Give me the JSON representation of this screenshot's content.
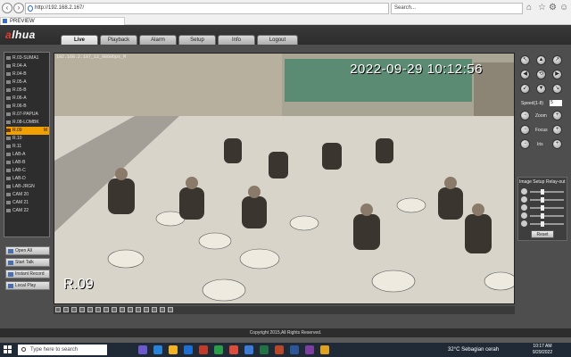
{
  "browser": {
    "url": "http://192.168.2.167/",
    "search_placeholder": "Search...",
    "tab_title": "PREVIEW"
  },
  "app": {
    "logo": "alhua",
    "tabs": [
      "Live",
      "Playback",
      "Alarm",
      "Setup",
      "Info",
      "Logout"
    ],
    "active_tab": "Live",
    "footer": "Copyright 2015,All Rights Reserved."
  },
  "channels": [
    "R.03-SUMA1",
    "R.04-A",
    "R.04-B",
    "R.05-A",
    "R.05-B",
    "R.06-A",
    "R.06-B",
    "R.07-PAPUA",
    "R.08-LOMBK",
    "R.09",
    "R.10",
    "R.11",
    "LAB-A",
    "LAB-B",
    "LAB-C",
    "LAB-D",
    "LAB-JRGN",
    "CAM 20",
    "CAM 21",
    "CAM 22"
  ],
  "selected_channel": "R.09",
  "selected_channel_flag": "M",
  "left_buttons": [
    "Open All",
    "Start Talk",
    "Instant Record",
    "Local Play"
  ],
  "video": {
    "osd_top": "192.168.2.167_12_9860bps_M",
    "timestamp": "2022-09-29 10:12:56",
    "camera_name": "R.09"
  },
  "ptz": {
    "speed_label": "Speed(1-8)",
    "speed_value": "5",
    "zoom_label": "Zoom",
    "focus_label": "Focus",
    "iris_label": "Iris",
    "image_setup_label": "Image Setup",
    "relay_label": "Relay-out",
    "reset_label": "Reset",
    "slider_levels": [
      0.35,
      0.35,
      0.35,
      0.35,
      0.35
    ]
  },
  "taskbar": {
    "search_placeholder": "Type here to search",
    "weather": "32°C  Sebagian cerah",
    "time": "10:17 AM",
    "date": "9/29/2022"
  }
}
